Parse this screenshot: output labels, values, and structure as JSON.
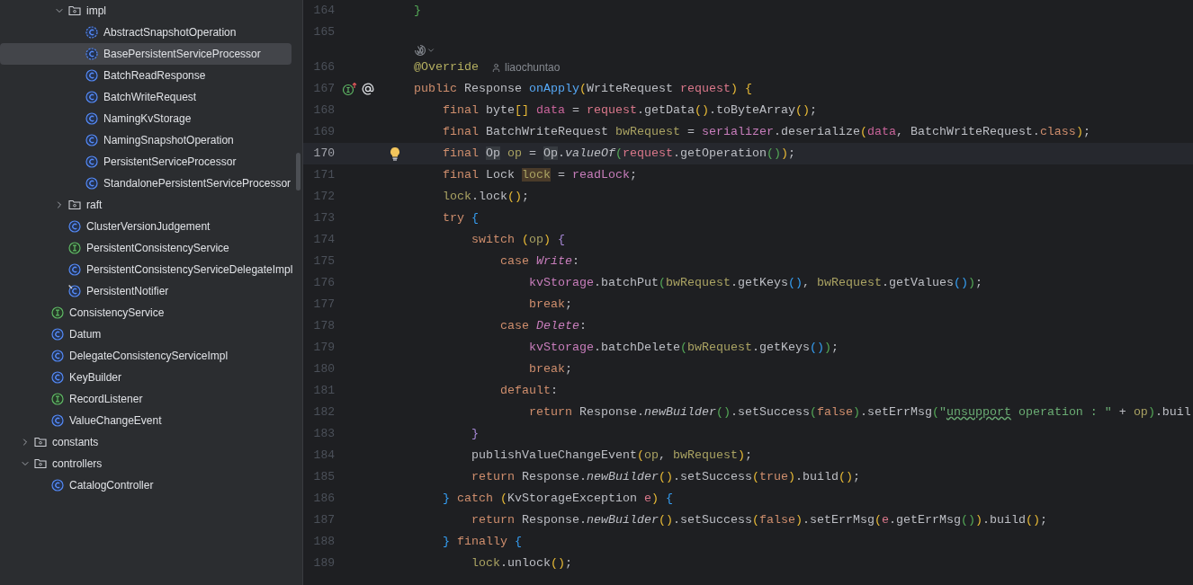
{
  "project_tree": [
    {
      "children": [
        {
          "children": [
            {
              "label": "impl",
              "kind": "folder",
              "expanded": true,
              "selected": false,
              "children": [
                {
                  "label": "AbstractSnapshotOperation",
                  "kind": "abstract",
                  "selected": false
                },
                {
                  "label": "BasePersistentServiceProcessor",
                  "kind": "abstract",
                  "selected": true
                },
                {
                  "label": "BatchReadResponse",
                  "kind": "class",
                  "selected": false
                },
                {
                  "label": "BatchWriteRequest",
                  "kind": "class",
                  "selected": false
                },
                {
                  "label": "NamingKvStorage",
                  "kind": "class",
                  "selected": false
                },
                {
                  "label": "NamingSnapshotOperation",
                  "kind": "class",
                  "selected": false
                },
                {
                  "label": "PersistentServiceProcessor",
                  "kind": "class",
                  "selected": false
                },
                {
                  "label": "StandalonePersistentServiceProcessor",
                  "kind": "class",
                  "selected": false
                }
              ]
            },
            {
              "label": "raft",
              "kind": "folder",
              "expanded": false,
              "selected": false
            },
            {
              "label": "ClusterVersionJudgement",
              "kind": "class",
              "selected": false
            },
            {
              "label": "PersistentConsistencyService",
              "kind": "interface",
              "selected": false
            },
            {
              "label": "PersistentConsistencyServiceDelegateImpl",
              "kind": "class",
              "selected": false
            },
            {
              "label": "PersistentNotifier",
              "kind": "marked",
              "selected": false
            }
          ]
        },
        {
          "label": "ConsistencyService",
          "kind": "interface",
          "selected": false
        },
        {
          "label": "Datum",
          "kind": "class",
          "selected": false
        },
        {
          "label": "DelegateConsistencyServiceImpl",
          "kind": "class",
          "selected": false
        },
        {
          "label": "KeyBuilder",
          "kind": "class",
          "selected": false
        },
        {
          "label": "RecordListener",
          "kind": "interface",
          "selected": false
        },
        {
          "label": "ValueChangeEvent",
          "kind": "class",
          "selected": false
        }
      ]
    },
    {
      "label": "constants",
      "kind": "folder",
      "expanded": false,
      "selected": false
    },
    {
      "label": "controllers",
      "kind": "folder",
      "expanded": true,
      "selected": false,
      "children": [
        {
          "label": "CatalogController",
          "kind": "class",
          "selected": false
        }
      ]
    }
  ],
  "editor": {
    "lines": [
      {
        "number": "164",
        "current": false,
        "code_vision": false,
        "tokens": [
          {
            "kind": "b2",
            "text": "}"
          }
        ]
      },
      {
        "number": "165",
        "current": false,
        "code_vision": false
      },
      {
        "number": "166",
        "current": false,
        "code_vision": true,
        "author": "liaochuntao",
        "tokens": [
          {
            "kind": "ann",
            "text": "@Override"
          }
        ]
      },
      {
        "number": "167",
        "current": false,
        "code_vision": false,
        "gutter_icons": [
          {
            "kind": "implementation"
          },
          {
            "kind": "mention"
          }
        ],
        "tokens": [
          {
            "kind": "kw",
            "text": "public"
          },
          {
            "kind": "plain",
            "text": " Response "
          },
          {
            "kind": "decl",
            "text": "onApply"
          },
          {
            "kind": "b1",
            "text": "("
          },
          {
            "kind": "plain",
            "text": "WriteRequest "
          },
          {
            "kind": "param",
            "text": "request"
          },
          {
            "kind": "b1",
            "text": ")"
          },
          {
            "kind": "b1",
            "text": " {"
          }
        ]
      },
      {
        "number": "168",
        "current": false,
        "code_vision": false,
        "tokens": [
          {
            "kind": "kw",
            "text": "    final"
          },
          {
            "kind": "plain",
            "text": " byte"
          },
          {
            "kind": "b1",
            "text": "[]"
          },
          {
            "kind": "local",
            "text": " data"
          },
          {
            "kind": "plain",
            "text": " = "
          },
          {
            "kind": "param",
            "text": "request"
          },
          {
            "kind": "plain",
            "text": ".getData"
          },
          {
            "kind": "b1",
            "text": "()"
          },
          {
            "kind": "plain",
            "text": ".toByteArray"
          },
          {
            "kind": "b1",
            "text": "()"
          },
          {
            "kind": "plain",
            "text": ";"
          }
        ]
      },
      {
        "number": "169",
        "current": false,
        "code_vision": false,
        "tokens": [
          {
            "kind": "kw",
            "text": "    final"
          },
          {
            "kind": "plain",
            "text": " BatchWriteRequest "
          },
          {
            "kind": "var",
            "text": "bwRequest"
          },
          {
            "kind": "plain",
            "text": " = "
          },
          {
            "kind": "field",
            "text": "serializer"
          },
          {
            "kind": "plain",
            "text": ".deserialize"
          },
          {
            "kind": "b1",
            "text": "("
          },
          {
            "kind": "local",
            "text": "data"
          },
          {
            "kind": "plain",
            "text": ", BatchWriteRequest."
          },
          {
            "kind": "kw",
            "text": "class"
          },
          {
            "kind": "b1",
            "text": ")"
          },
          {
            "kind": "plain",
            "text": ";"
          }
        ]
      },
      {
        "number": "170",
        "current": true,
        "code_vision": false,
        "gutter_icons": [
          {
            "kind": "bulb"
          }
        ],
        "tokens": [
          {
            "kind": "kw",
            "text": "    final "
          },
          {
            "kind": "type_hl",
            "text": "Op"
          },
          {
            "kind": "var",
            "text": " op"
          },
          {
            "kind": "plain",
            "text": " = "
          },
          {
            "kind": "type_hl",
            "text": "Op"
          },
          {
            "kind": "plain",
            "text": "."
          },
          {
            "kind": "static",
            "text": "valueOf"
          },
          {
            "kind": "b2",
            "text": "("
          },
          {
            "kind": "param",
            "text": "request"
          },
          {
            "kind": "plain",
            "text": ".getOperation"
          },
          {
            "kind": "b2",
            "text": "()"
          },
          {
            "kind": "b1",
            "text": ")"
          },
          {
            "kind": "plain",
            "text": ";"
          }
        ]
      },
      {
        "number": "171",
        "current": false,
        "code_vision": false,
        "tokens": [
          {
            "kind": "kw",
            "text": "    final"
          },
          {
            "kind": "plain",
            "text": " Lock "
          },
          {
            "kind": "var_hl",
            "text": "lock"
          },
          {
            "kind": "plain",
            "text": " = "
          },
          {
            "kind": "field",
            "text": "readLock"
          },
          {
            "kind": "plain",
            "text": ";"
          }
        ]
      },
      {
        "number": "172",
        "current": false,
        "code_vision": false,
        "tokens": [
          {
            "kind": "var",
            "text": "    lock"
          },
          {
            "kind": "plain",
            "text": ".lock"
          },
          {
            "kind": "b1",
            "text": "()"
          },
          {
            "kind": "plain",
            "text": ";"
          }
        ]
      },
      {
        "number": "173",
        "current": false,
        "code_vision": false,
        "tokens": [
          {
            "kind": "kw",
            "text": "    try"
          },
          {
            "kind": "b3",
            "text": " {"
          }
        ]
      },
      {
        "number": "174",
        "current": false,
        "code_vision": false,
        "tokens": [
          {
            "kind": "kw",
            "text": "        switch"
          },
          {
            "kind": "b1",
            "text": " ("
          },
          {
            "kind": "var",
            "text": "op"
          },
          {
            "kind": "b1",
            "text": ")"
          },
          {
            "kind": "b4",
            "text": " {"
          }
        ]
      },
      {
        "number": "175",
        "current": false,
        "code_vision": false,
        "tokens": [
          {
            "kind": "kw",
            "text": "            case"
          },
          {
            "kind": "enum",
            "text": " Write"
          },
          {
            "kind": "plain",
            "text": ":"
          }
        ]
      },
      {
        "number": "176",
        "current": false,
        "code_vision": false,
        "tokens": [
          {
            "kind": "field",
            "text": "                kvStorage"
          },
          {
            "kind": "plain",
            "text": ".batchPut"
          },
          {
            "kind": "b2",
            "text": "("
          },
          {
            "kind": "var",
            "text": "bwRequest"
          },
          {
            "kind": "plain",
            "text": ".getKeys"
          },
          {
            "kind": "b3",
            "text": "()"
          },
          {
            "kind": "plain",
            "text": ", "
          },
          {
            "kind": "var",
            "text": "bwRequest"
          },
          {
            "kind": "plain",
            "text": ".getValues"
          },
          {
            "kind": "b3",
            "text": "()"
          },
          {
            "kind": "b2",
            "text": ")"
          },
          {
            "kind": "plain",
            "text": ";"
          }
        ]
      },
      {
        "number": "177",
        "current": false,
        "code_vision": false,
        "tokens": [
          {
            "kind": "kw",
            "text": "                break"
          },
          {
            "kind": "plain",
            "text": ";"
          }
        ]
      },
      {
        "number": "178",
        "current": false,
        "code_vision": false,
        "tokens": [
          {
            "kind": "kw",
            "text": "            case"
          },
          {
            "kind": "enum",
            "text": " Delete"
          },
          {
            "kind": "plain",
            "text": ":"
          }
        ]
      },
      {
        "number": "179",
        "current": false,
        "code_vision": false,
        "tokens": [
          {
            "kind": "field",
            "text": "                kvStorage"
          },
          {
            "kind": "plain",
            "text": ".batchDelete"
          },
          {
            "kind": "b2",
            "text": "("
          },
          {
            "kind": "var",
            "text": "bwRequest"
          },
          {
            "kind": "plain",
            "text": ".getKeys"
          },
          {
            "kind": "b3",
            "text": "()"
          },
          {
            "kind": "b2",
            "text": ")"
          },
          {
            "kind": "plain",
            "text": ";"
          }
        ]
      },
      {
        "number": "180",
        "current": false,
        "code_vision": false,
        "tokens": [
          {
            "kind": "kw",
            "text": "                break"
          },
          {
            "kind": "plain",
            "text": ";"
          }
        ]
      },
      {
        "number": "181",
        "current": false,
        "code_vision": false,
        "tokens": [
          {
            "kind": "kw",
            "text": "            default"
          },
          {
            "kind": "plain",
            "text": ":"
          }
        ]
      },
      {
        "number": "182",
        "current": false,
        "code_vision": false,
        "tokens": [
          {
            "kind": "kw",
            "text": "                return"
          },
          {
            "kind": "plain",
            "text": " Response."
          },
          {
            "kind": "static",
            "text": "newBuilder"
          },
          {
            "kind": "b2",
            "text": "()"
          },
          {
            "kind": "plain",
            "text": ".setSuccess"
          },
          {
            "kind": "b2",
            "text": "("
          },
          {
            "kind": "kw",
            "text": "false"
          },
          {
            "kind": "b2",
            "text": ")"
          },
          {
            "kind": "plain",
            "text": ".setErrMsg"
          },
          {
            "kind": "b2",
            "text": "("
          },
          {
            "kind": "string",
            "text": "\""
          },
          {
            "kind": "string_typo",
            "text": "unsupport"
          },
          {
            "kind": "string",
            "text": " operation : \""
          },
          {
            "kind": "plain",
            "text": " + "
          },
          {
            "kind": "var",
            "text": "op"
          },
          {
            "kind": "b2",
            "text": ")"
          },
          {
            "kind": "plain",
            "text": ".buil"
          }
        ]
      },
      {
        "number": "183",
        "current": false,
        "code_vision": false,
        "tokens": [
          {
            "kind": "b4",
            "text": "        }"
          }
        ]
      },
      {
        "number": "184",
        "current": false,
        "code_vision": false,
        "tokens": [
          {
            "kind": "plain",
            "text": "        publishValueChangeEvent"
          },
          {
            "kind": "b1",
            "text": "("
          },
          {
            "kind": "var",
            "text": "op"
          },
          {
            "kind": "plain",
            "text": ", "
          },
          {
            "kind": "var",
            "text": "bwRequest"
          },
          {
            "kind": "b1",
            "text": ")"
          },
          {
            "kind": "plain",
            "text": ";"
          }
        ]
      },
      {
        "number": "185",
        "current": false,
        "code_vision": false,
        "tokens": [
          {
            "kind": "kw",
            "text": "        return"
          },
          {
            "kind": "plain",
            "text": " Response."
          },
          {
            "kind": "static",
            "text": "newBuilder"
          },
          {
            "kind": "b1",
            "text": "()"
          },
          {
            "kind": "plain",
            "text": ".setSuccess"
          },
          {
            "kind": "b1",
            "text": "("
          },
          {
            "kind": "kw",
            "text": "true"
          },
          {
            "kind": "b1",
            "text": ")"
          },
          {
            "kind": "plain",
            "text": ".build"
          },
          {
            "kind": "b1",
            "text": "()"
          },
          {
            "kind": "plain",
            "text": ";"
          }
        ]
      },
      {
        "number": "186",
        "current": false,
        "code_vision": false,
        "tokens": [
          {
            "kind": "b3",
            "text": "    }"
          },
          {
            "kind": "kw",
            "text": " catch"
          },
          {
            "kind": "b1",
            "text": " ("
          },
          {
            "kind": "plain",
            "text": "KvStorageException "
          },
          {
            "kind": "param",
            "text": "e"
          },
          {
            "kind": "b1",
            "text": ")"
          },
          {
            "kind": "b3",
            "text": " {"
          }
        ]
      },
      {
        "number": "187",
        "current": false,
        "code_vision": false,
        "tokens": [
          {
            "kind": "kw",
            "text": "        return"
          },
          {
            "kind": "plain",
            "text": " Response."
          },
          {
            "kind": "static",
            "text": "newBuilder"
          },
          {
            "kind": "b1",
            "text": "()"
          },
          {
            "kind": "plain",
            "text": ".setSuccess"
          },
          {
            "kind": "b1",
            "text": "("
          },
          {
            "kind": "kw",
            "text": "false"
          },
          {
            "kind": "b1",
            "text": ")"
          },
          {
            "kind": "plain",
            "text": ".setErrMsg"
          },
          {
            "kind": "b1",
            "text": "("
          },
          {
            "kind": "param",
            "text": "e"
          },
          {
            "kind": "plain",
            "text": ".getErrMsg"
          },
          {
            "kind": "b2",
            "text": "()"
          },
          {
            "kind": "b1",
            "text": ")"
          },
          {
            "kind": "plain",
            "text": ".build"
          },
          {
            "kind": "b1",
            "text": "()"
          },
          {
            "kind": "plain",
            "text": ";"
          }
        ]
      },
      {
        "number": "188",
        "current": false,
        "code_vision": false,
        "tokens": [
          {
            "kind": "b3",
            "text": "    }"
          },
          {
            "kind": "kw",
            "text": " finally"
          },
          {
            "kind": "b3",
            "text": " {"
          }
        ]
      },
      {
        "number": "189",
        "current": false,
        "code_vision": false,
        "tokens": [
          {
            "kind": "var",
            "text": "        lock"
          },
          {
            "kind": "plain",
            "text": ".unlock"
          },
          {
            "kind": "b1",
            "text": "()"
          },
          {
            "kind": "plain",
            "text": ";"
          }
        ]
      }
    ]
  }
}
